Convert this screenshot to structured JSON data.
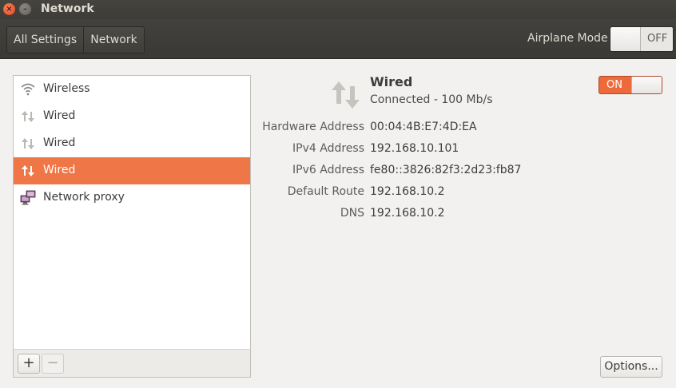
{
  "window": {
    "title": "Network",
    "close_glyph": "×",
    "minimize_glyph": "–"
  },
  "header": {
    "breadcrumbs": [
      "All Settings",
      "Network"
    ],
    "airplane_mode_label": "Airplane Mode",
    "airplane_mode_state": "OFF"
  },
  "sidebar": {
    "items": [
      {
        "label": "Wireless",
        "icon": "wifi-icon",
        "selected": false
      },
      {
        "label": "Wired",
        "icon": "wired-arrows-icon",
        "selected": false
      },
      {
        "label": "Wired",
        "icon": "wired-arrows-icon",
        "selected": false
      },
      {
        "label": "Wired",
        "icon": "wired-arrows-icon",
        "selected": true
      },
      {
        "label": "Network proxy",
        "icon": "network-proxy-icon",
        "selected": false
      }
    ],
    "add_label": "+",
    "remove_label": "−"
  },
  "detail": {
    "name": "Wired",
    "status": "Connected - 100 Mb/s",
    "switch_state": "ON",
    "properties": [
      {
        "label": "Hardware Address",
        "value": "00:04:4B:E7:4D:EA"
      },
      {
        "label": "IPv4 Address",
        "value": "192.168.10.101"
      },
      {
        "label": "IPv6 Address",
        "value": "fe80::3826:82f3:2d23:fb87"
      },
      {
        "label": "Default Route",
        "value": "192.168.10.2"
      },
      {
        "label": "DNS",
        "value": "192.168.10.2"
      }
    ],
    "options_label": "Options..."
  },
  "colors": {
    "accent": "#ef7646",
    "titlebar": "#3d3c38"
  }
}
